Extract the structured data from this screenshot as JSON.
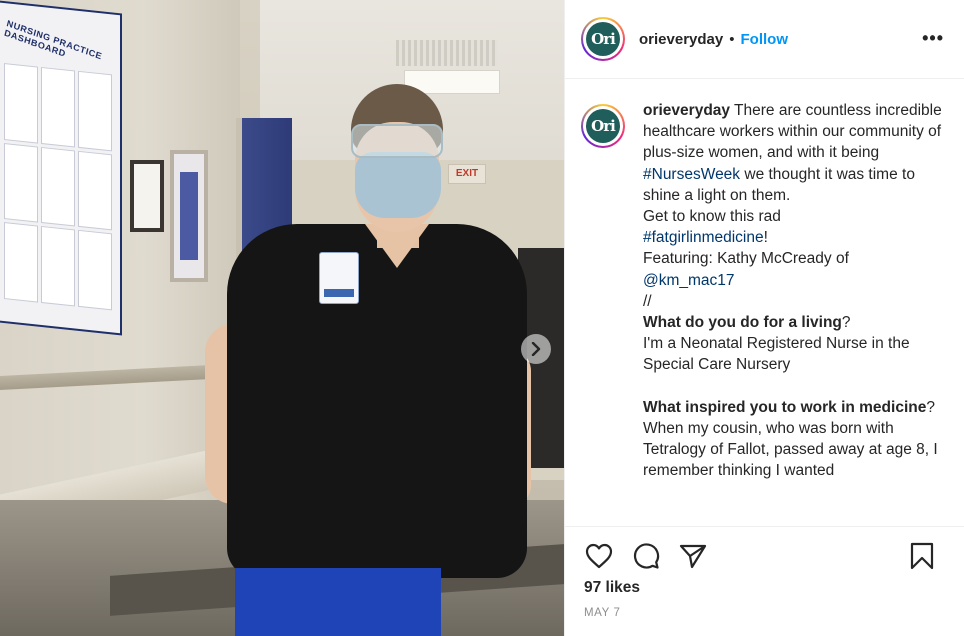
{
  "post": {
    "username": "orieveryday",
    "avatar_text": "Ori",
    "separator": "•",
    "follow_label": "Follow",
    "more_label": "•••",
    "caption": {
      "username": "orieveryday",
      "line1_text": " There are countless incredible healthcare workers within our community of plus-size women, and with it being ",
      "hashtag1": "#NursesWeek",
      "line1_after": " we thought it was time to shine a light on them.",
      "line2": "Get to know this rad",
      "hashtag2": "#fatgirlinmedicine",
      "hashtag2_after": "!",
      "featuring": "Featuring: Kathy McCready of",
      "mention": "@km_mac17",
      "slashes": "//",
      "q1": "What do you do for a living",
      "q1_after": "?",
      "a1": "I'm a Neonatal Registered Nurse in the Special Care Nursery",
      "q2": "What inspired you to work in medicine",
      "q2_after": "?",
      "a2": "When my cousin, who was born with Tetralogy of Fallot, passed away at age 8, I remember thinking I wanted"
    },
    "likes": "97 likes",
    "date": "MAY 7"
  },
  "photo": {
    "dashboard_title": "NURSING PRACTICE DASHBOARD",
    "exit_sign": "EXIT"
  },
  "icons": {
    "like": "heart-icon",
    "comment": "comment-icon",
    "share": "paper-plane-icon",
    "save": "bookmark-icon",
    "next": "chevron-right-icon"
  },
  "colors": {
    "follow": "#0095f6",
    "link": "#00376b",
    "text": "#262626",
    "muted": "#8e8e8e"
  }
}
